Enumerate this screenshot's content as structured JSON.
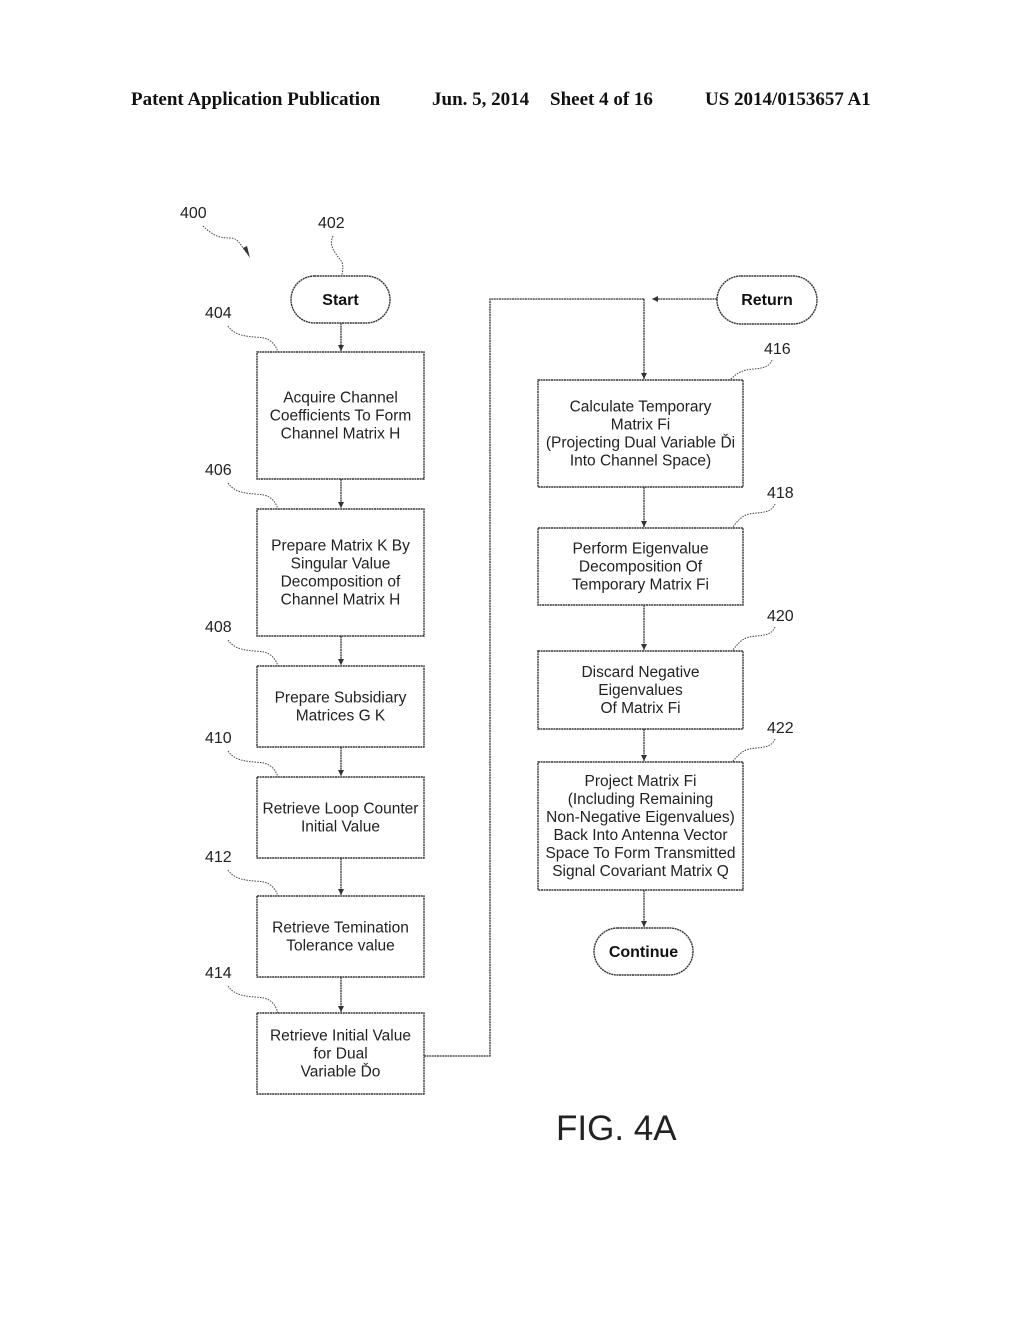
{
  "header": {
    "publication_type": "Patent Application Publication",
    "date": "Jun. 5, 2014",
    "sheet": "Sheet 4 of 16",
    "patent_number": "US 2014/0153657 A1"
  },
  "figure": {
    "label": "FIG. 4A",
    "diagram_ref": "400"
  },
  "terminals": {
    "start": {
      "ref": "402",
      "label": "Start"
    },
    "return": {
      "label": "Return"
    },
    "continue": {
      "label": "Continue"
    }
  },
  "steps": [
    {
      "ref": "404",
      "lines": [
        "Acquire Channel",
        "Coefficients To Form",
        "Channel Matrix H"
      ]
    },
    {
      "ref": "406",
      "lines": [
        "Prepare Matrix K By",
        "Singular Value",
        "Decomposition of",
        "Channel Matrix H"
      ]
    },
    {
      "ref": "408",
      "lines": [
        "Prepare Subsidiary",
        "Matrices G K"
      ]
    },
    {
      "ref": "410",
      "lines": [
        "Retrieve Loop Counter",
        "Initial Value"
      ]
    },
    {
      "ref": "412",
      "lines": [
        "Retrieve Temination",
        "Tolerance value"
      ]
    },
    {
      "ref": "414",
      "lines": [
        "Retrieve Initial Value",
        "for Dual",
        "Variable Ďo"
      ]
    },
    {
      "ref": "416",
      "lines": [
        "Calculate Temporary",
        "Matrix Fi",
        "(Projecting Dual Variable Ďi",
        "Into Channel Space)"
      ]
    },
    {
      "ref": "418",
      "lines": [
        "Perform Eigenvalue",
        "Decomposition Of",
        "Temporary Matrix Fi"
      ]
    },
    {
      "ref": "420",
      "lines": [
        "Discard Negative",
        "Eigenvalues",
        "Of Matrix Fi"
      ]
    },
    {
      "ref": "422",
      "lines": [
        "Project Matrix Fi",
        "(Including Remaining",
        "Non-Negative Eigenvalues)",
        "Back Into Antenna Vector",
        "Space To Form Transmitted",
        "Signal Covariant Matrix Q"
      ]
    }
  ]
}
